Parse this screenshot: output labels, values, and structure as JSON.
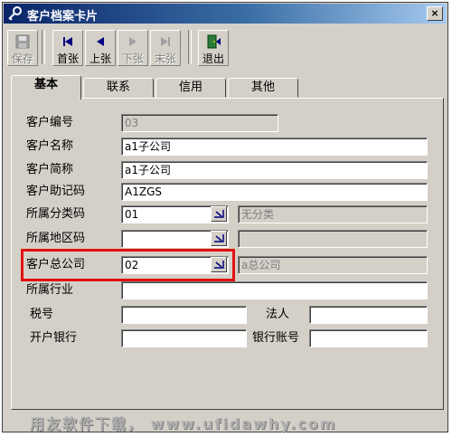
{
  "window": {
    "title": "客户档案卡片",
    "close_label": "×"
  },
  "toolbar": {
    "buttons": [
      {
        "label": "保存",
        "icon": "disk-icon",
        "enabled": false
      },
      {
        "label": "首张",
        "icon": "first-record-icon",
        "enabled": true
      },
      {
        "label": "上张",
        "icon": "prev-record-icon",
        "enabled": true
      },
      {
        "label": "下张",
        "icon": "next-record-icon",
        "enabled": false
      },
      {
        "label": "末张",
        "icon": "last-record-icon",
        "enabled": false
      },
      {
        "label": "退出",
        "icon": "exit-door-icon",
        "enabled": true
      }
    ]
  },
  "tabs": [
    {
      "label": "基本",
      "active": true
    },
    {
      "label": "联系",
      "active": false
    },
    {
      "label": "信用",
      "active": false
    },
    {
      "label": "其他",
      "active": false
    }
  ],
  "form": {
    "customer_code": {
      "label": "客户编号",
      "value": "03"
    },
    "customer_name": {
      "label": "客户名称",
      "value": "a1子公司"
    },
    "customer_short": {
      "label": "客户简称",
      "value": "a1子公司"
    },
    "mnemonic": {
      "label": "客户助记码",
      "value": "A1ZGS"
    },
    "category_code": {
      "label": "所属分类码",
      "value": "01",
      "desc": "无分类"
    },
    "region_code": {
      "label": "所属地区码",
      "value": "",
      "desc": ""
    },
    "parent_company": {
      "label": "客户总公司",
      "value": "02",
      "desc": "a总公司"
    },
    "industry": {
      "label": "所属行业",
      "value": ""
    },
    "tax_no": {
      "label": "税号",
      "value": ""
    },
    "legal_person": {
      "label": "法人",
      "value": ""
    },
    "bank": {
      "label": "开户银行",
      "value": ""
    },
    "bank_account": {
      "label": "银行账号",
      "value": ""
    }
  },
  "watermark": "用友软件下载， www.ufidawhy.com",
  "colors": {
    "titlebar_start": "#0a246a",
    "titlebar_end": "#a6caf0",
    "highlight": "#e01010",
    "face": "#d4d0c8"
  }
}
